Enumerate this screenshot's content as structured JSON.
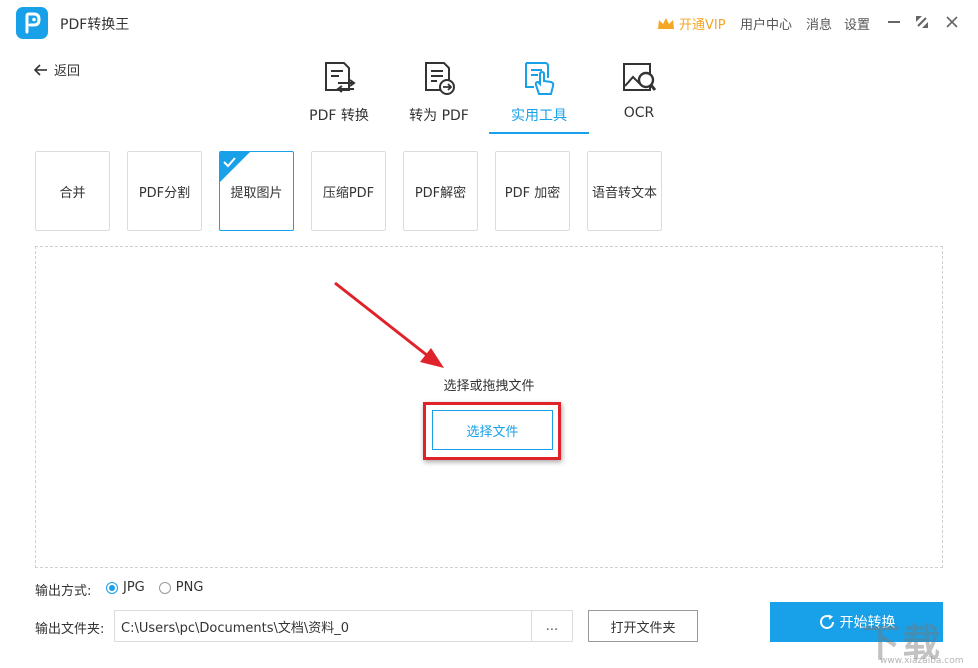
{
  "app": {
    "title": "PDF转换王"
  },
  "header": {
    "vip_label": "开通VIP",
    "user_center": "用户中心",
    "messages": "消息",
    "settings": "设置"
  },
  "nav": {
    "back_label": "返回"
  },
  "tabs": [
    {
      "label": "PDF 转换",
      "icon": "pdf-convert-icon"
    },
    {
      "label": "转为 PDF",
      "icon": "to-pdf-icon"
    },
    {
      "label": "实用工具",
      "icon": "tools-icon",
      "active": true
    },
    {
      "label": "OCR",
      "icon": "ocr-icon"
    }
  ],
  "tools": [
    {
      "label": "合并"
    },
    {
      "label": "PDF分割"
    },
    {
      "label": "提取图片",
      "active": true
    },
    {
      "label": "压缩PDF"
    },
    {
      "label": "PDF解密"
    },
    {
      "label": "PDF 加密"
    },
    {
      "label": "语音转文本"
    }
  ],
  "dropzone": {
    "hint": "选择或拖拽文件",
    "button_label": "选择文件"
  },
  "output": {
    "format_label": "输出方式:",
    "formats": [
      {
        "label": "JPG",
        "checked": true
      },
      {
        "label": "PNG",
        "checked": false
      }
    ],
    "folder_label": "输出文件夹:",
    "folder_path": "C:\\Users\\pc\\Documents\\文档\\资料_0",
    "browse_label": "...",
    "open_folder_label": "打开文件夹"
  },
  "start_button": {
    "label": "开始转换"
  },
  "watermark": {
    "text": "下载",
    "sub": "www.xiazaiba.com"
  },
  "colors": {
    "accent": "#18a0e8",
    "vip": "#f5a623",
    "highlight": "#e0222a"
  }
}
